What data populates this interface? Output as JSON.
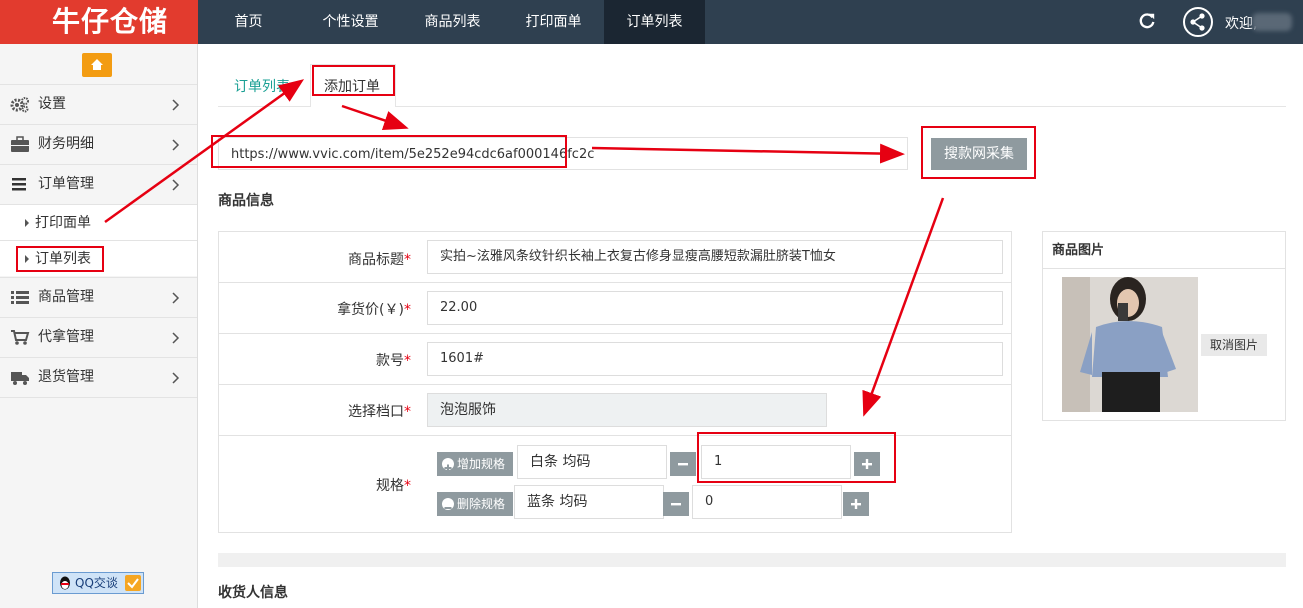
{
  "brand": {
    "logo_text": "牛仔仓储"
  },
  "nav": [
    {
      "label": "首页"
    },
    {
      "label": "个性设置"
    },
    {
      "label": "商品列表"
    },
    {
      "label": "打印面单"
    },
    {
      "label": "订单列表"
    }
  ],
  "header": {
    "welcome": "欢迎,"
  },
  "sidebar": {
    "items": [
      {
        "label": "设置",
        "icon": "gear-icon"
      },
      {
        "label": "财务明细",
        "icon": "briefcase-icon"
      },
      {
        "label": "订单管理",
        "icon": "menu-icon"
      },
      {
        "label": "商品管理",
        "icon": "list-icon"
      },
      {
        "label": "代拿管理",
        "icon": "cart-icon"
      },
      {
        "label": "退货管理",
        "icon": "truck-icon"
      }
    ],
    "sub_items": [
      {
        "label": "打印面单"
      },
      {
        "label": "订单列表"
      }
    ],
    "qq_label": "QQ交谈"
  },
  "tabs": [
    {
      "label": "订单列表"
    },
    {
      "label": "添加订单"
    }
  ],
  "collect": {
    "url": "https://www.vvic.com/item/5e252e94cdc6af000146fc2c",
    "button": "搜款网采集"
  },
  "product_section_title": "商品信息",
  "form": {
    "title_label": "商品标题",
    "title_value": "实拍~泫雅风条纹针织长袖上衣复古修身显瘦高腰短款漏肚脐装T恤女",
    "price_label": "拿货价(￥)",
    "price_value": "22.00",
    "sku_label": "款号",
    "sku_value": "1601#",
    "stall_label": "选择档口",
    "stall_value": "泡泡服饰",
    "spec_label": "规格",
    "required_mark": "*",
    "add_spec": "增加规格",
    "remove_spec": "删除规格",
    "specs": [
      {
        "name": "白条 均码",
        "qty": "1"
      },
      {
        "name": "蓝条 均码",
        "qty": "0"
      }
    ]
  },
  "image_panel": {
    "title": "商品图片",
    "cancel": "取消图片"
  },
  "receiver_section_title": "收货人信息"
}
